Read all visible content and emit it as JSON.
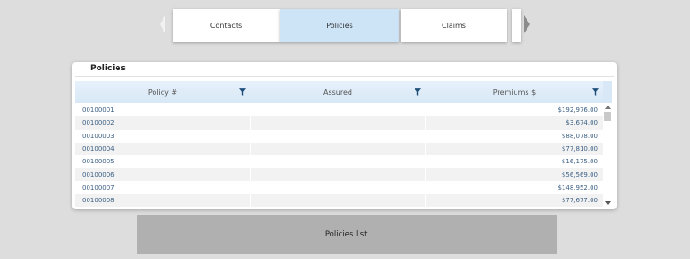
{
  "tabs": [
    {
      "label": "Contacts",
      "selected": false
    },
    {
      "label": "Policies",
      "selected": true
    },
    {
      "label": "Claims",
      "selected": false
    }
  ],
  "panel": {
    "title": "Policies",
    "columns": [
      "Policy #",
      "Assured",
      "Premiums $"
    ],
    "rows": [
      {
        "policy": "00100001",
        "assured": "",
        "premium": "$192,976.00"
      },
      {
        "policy": "00100002",
        "assured": "",
        "premium": "$3,674.00"
      },
      {
        "policy": "00100003",
        "assured": "",
        "premium": "$88,078.00"
      },
      {
        "policy": "00100004",
        "assured": "",
        "premium": "$77,810.00"
      },
      {
        "policy": "00100005",
        "assured": "",
        "premium": "$16,175.00"
      },
      {
        "policy": "00100006",
        "assured": "",
        "premium": "$56,569.00"
      },
      {
        "policy": "00100007",
        "assured": "",
        "premium": "$148,952.00"
      },
      {
        "policy": "00100008",
        "assured": "",
        "premium": "$77,677.00"
      }
    ]
  },
  "caption": "Policies list.",
  "colors": {
    "selected_tab": "#cde3f6",
    "header": "#d8e8f6",
    "link_text": "#3b5f84",
    "filter_icon": "#1f4e79"
  },
  "icons": {
    "filter": "filter-icon",
    "prev": "chevron-left-icon",
    "next": "chevron-right-icon"
  }
}
